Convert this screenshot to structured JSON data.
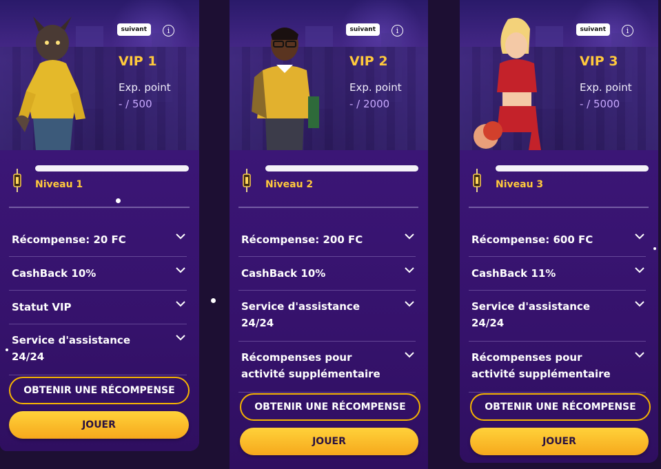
{
  "cards": [
    {
      "badge": "suivant",
      "vip": "VIP 1",
      "exp_label": "Exp. point",
      "exp_value": "- / 500",
      "level": "Niveau 1",
      "rows": [
        "Récompense: 20 FC",
        "CashBack 10%",
        "Statut VIP",
        "Service d'assistance 24/24"
      ],
      "claim_label": "OBTENIR UNE RÉCOMPENSE",
      "play_label": "JOUER",
      "progress": 0
    },
    {
      "badge": "suivant",
      "vip": "VIP 2",
      "exp_label": "Exp. point",
      "exp_value": "- / 2000",
      "level": "Niveau 2",
      "rows": [
        "Récompense: 200 FC",
        "CashBack 10%",
        "Service d'assistance 24/24",
        "Récompenses pour activité supplémentaire"
      ],
      "claim_label": "OBTENIR UNE RÉCOMPENSE",
      "play_label": "JOUER",
      "progress": 0
    },
    {
      "badge": "suivant",
      "vip": "VIP 3",
      "exp_label": "Exp. point",
      "exp_value": "- / 5000",
      "level": "Niveau 3",
      "rows": [
        "Récompense: 600 FC",
        "CashBack 11%",
        "Service d'assistance 24/24",
        "Récompenses pour activité supplémentaire"
      ],
      "claim_label": "OBTENIR UNE RÉCOMPENSE",
      "play_label": "JOUER",
      "progress": 0
    }
  ],
  "colors": {
    "accent": "#ffc93c",
    "card_bg": "#3a1577",
    "page_bg": "#1d0f33",
    "play_gradient": [
      "#ffd23a",
      "#f6a81c"
    ]
  },
  "icons": {
    "info": "info-icon",
    "chevron": "chevron-down-icon",
    "lantern": "lantern-icon"
  }
}
